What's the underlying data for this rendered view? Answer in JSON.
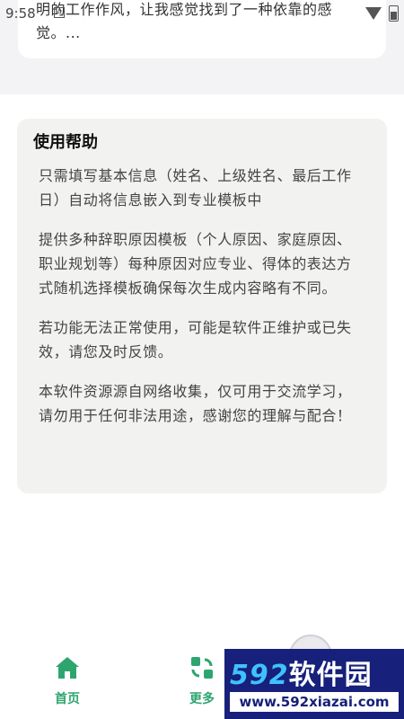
{
  "status_bar": {
    "time": "9:58"
  },
  "review_card": {
    "text": "明的工作作风，让我感觉找到了一种依靠的感觉。..."
  },
  "help": {
    "title": "使用帮助",
    "paragraphs": [
      "只需填写基本信息（姓名、上级姓名、最后工作日）自动将信息嵌入到专业模板中",
      "提供多种辞职原因模板（个人原因、家庭原因、职业规划等）每种原因对应专业、得体的表达方式随机选择模板确保每次生成内容略有不同。",
      "若功能无法正常使用，可能是软件正维护或已失效，请您及时反馈。",
      "本软件资源源自网络收集，仅可用于交流学习，请勿用于任何非法用途，感谢您的理解与配合！"
    ]
  },
  "tabbar": {
    "home_label": "首页",
    "more_label": "更多",
    "accent_color": "#2ea56f"
  },
  "watermark": {
    "logo_number": "592",
    "logo_text": "软件园",
    "url": "www.592xiazai.com"
  }
}
